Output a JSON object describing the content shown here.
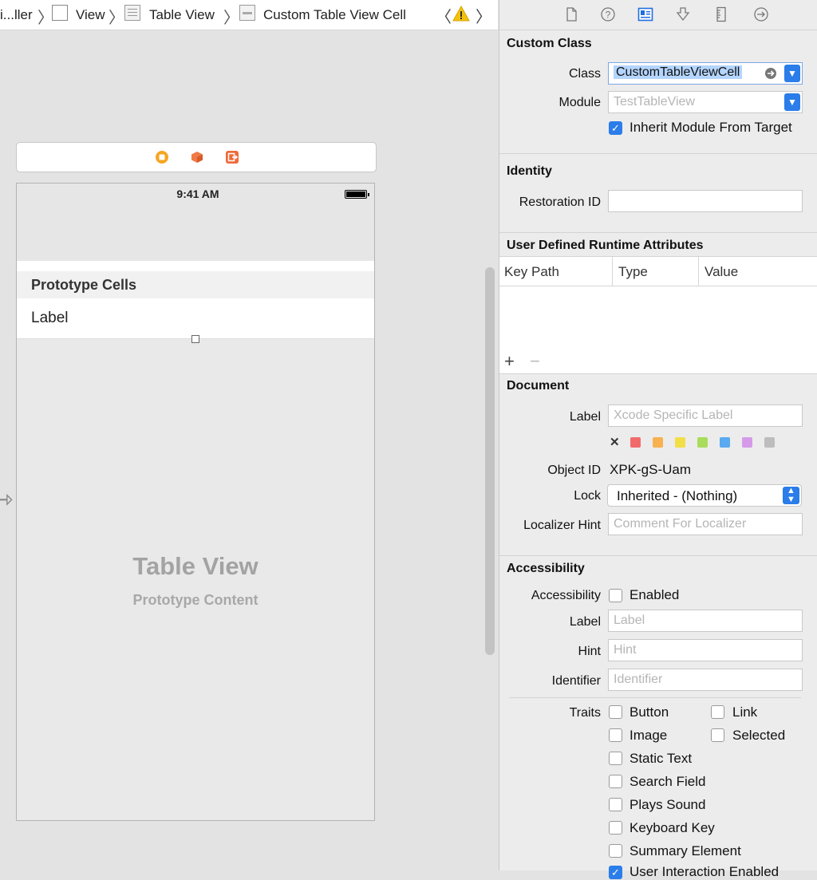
{
  "breadcrumb": {
    "items": [
      "i...ller",
      "View",
      "Table View",
      "Custom Table View Cell"
    ]
  },
  "inspector_tabs": [
    "file-inspector",
    "quick-help",
    "identity-inspector",
    "attributes-inspector",
    "size-inspector",
    "connections-inspector"
  ],
  "canvas": {
    "status_time": "9:41 AM",
    "section_header": "Prototype Cells",
    "cell_label": "Label",
    "placeholder_title": "Table View",
    "placeholder_subtitle": "Prototype Content"
  },
  "custom_class": {
    "title": "Custom Class",
    "class_label": "Class",
    "class_value": "CustomTableViewCell",
    "module_label": "Module",
    "module_placeholder": "TestTableView",
    "inherit_label": "Inherit Module From Target",
    "inherit_checked": true
  },
  "identity": {
    "title": "Identity",
    "restoration_label": "Restoration ID",
    "restoration_value": ""
  },
  "runtime_attributes": {
    "title": "User Defined Runtime Attributes",
    "columns": [
      "Key Path",
      "Type",
      "Value"
    ],
    "add_symbol": "+",
    "remove_symbol": "−"
  },
  "document": {
    "title": "Document",
    "label_label": "Label",
    "label_placeholder": "Xcode Specific Label",
    "colors": [
      "#f26b6b",
      "#f7b14f",
      "#f2df48",
      "#a9dc5c",
      "#5aaaf0",
      "#d59ae8",
      "#bdbdbd"
    ],
    "clear_symbol": "✕",
    "object_id_label": "Object ID",
    "object_id_value": "XPK-gS-Uam",
    "lock_label": "Lock",
    "lock_value": "Inherited - (Nothing)",
    "localizer_label": "Localizer Hint",
    "localizer_placeholder": "Comment For Localizer"
  },
  "accessibility": {
    "title": "Accessibility",
    "accessibility_label": "Accessibility",
    "enabled_label": "Enabled",
    "label_label": "Label",
    "label_placeholder": "Label",
    "hint_label": "Hint",
    "hint_placeholder": "Hint",
    "identifier_label": "Identifier",
    "identifier_placeholder": "Identifier",
    "traits_label": "Traits",
    "traits": {
      "button": "Button",
      "link": "Link",
      "image": "Image",
      "selected": "Selected",
      "static_text": "Static Text",
      "search_field": "Search Field",
      "plays_sound": "Plays Sound",
      "keyboard_key": "Keyboard Key",
      "summary_element": "Summary Element",
      "user_interaction": "User Interaction Enabled"
    }
  }
}
